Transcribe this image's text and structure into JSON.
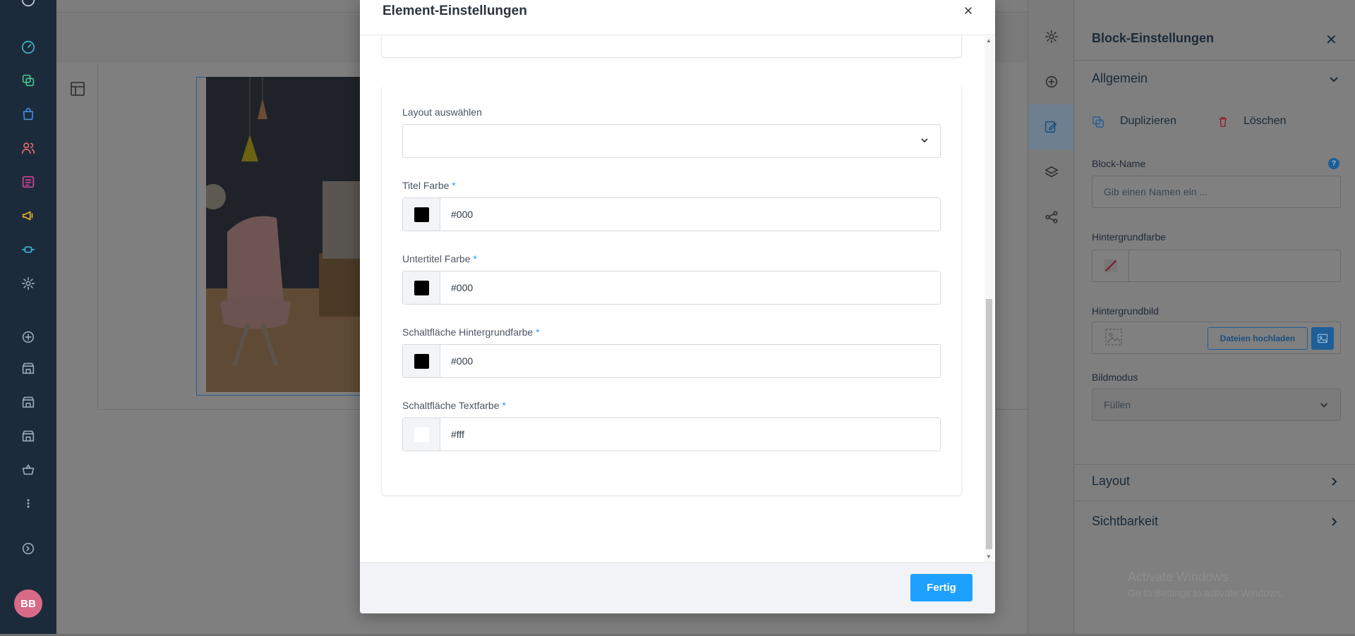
{
  "modal": {
    "title": "Element-Einstellungen",
    "close_icon": "close-icon",
    "fields": {
      "layout_label": "Layout auswählen",
      "layout_value": "",
      "title_color_label": "Titel Farbe",
      "title_color_value": "#000",
      "subtitle_color_label": "Untertitel Farbe",
      "subtitle_color_value": "#000",
      "button_bg_label": "Schaltfläche Hintergrundfarbe",
      "button_bg_value": "#000",
      "button_text_label": "Schaltfläche Textfarbe",
      "button_text_value": "#fff",
      "required_mark": "*"
    },
    "done_label": "Fertig"
  },
  "right_panel": {
    "title": "Block-Einstellungen",
    "section_general": "Allgemein",
    "duplicate_label": "Duplizieren",
    "delete_label": "Löschen",
    "block_name_label": "Block-Name",
    "block_name_placeholder": "Gib einen Namen ein ...",
    "help_mark": "?",
    "bg_color_label": "Hintergrundfarbe",
    "bg_image_label": "Hintergrundbild",
    "upload_label": "Dateien hochladen",
    "image_mode_label": "Bildmodus",
    "image_mode_value": "Füllen",
    "section_layout": "Layout",
    "section_visibility": "Sichtbarkeit"
  },
  "user": {
    "initials": "BB"
  },
  "watermark": {
    "line1": "Activate Windows",
    "line2": "Go to Settings to activate Windows."
  },
  "colors": {
    "accent": "#1ea0ff",
    "nav_bg": "#1c2b3b",
    "avatar": "#d86a88",
    "swatch_black": "#000000",
    "swatch_white": "#ffffff"
  }
}
